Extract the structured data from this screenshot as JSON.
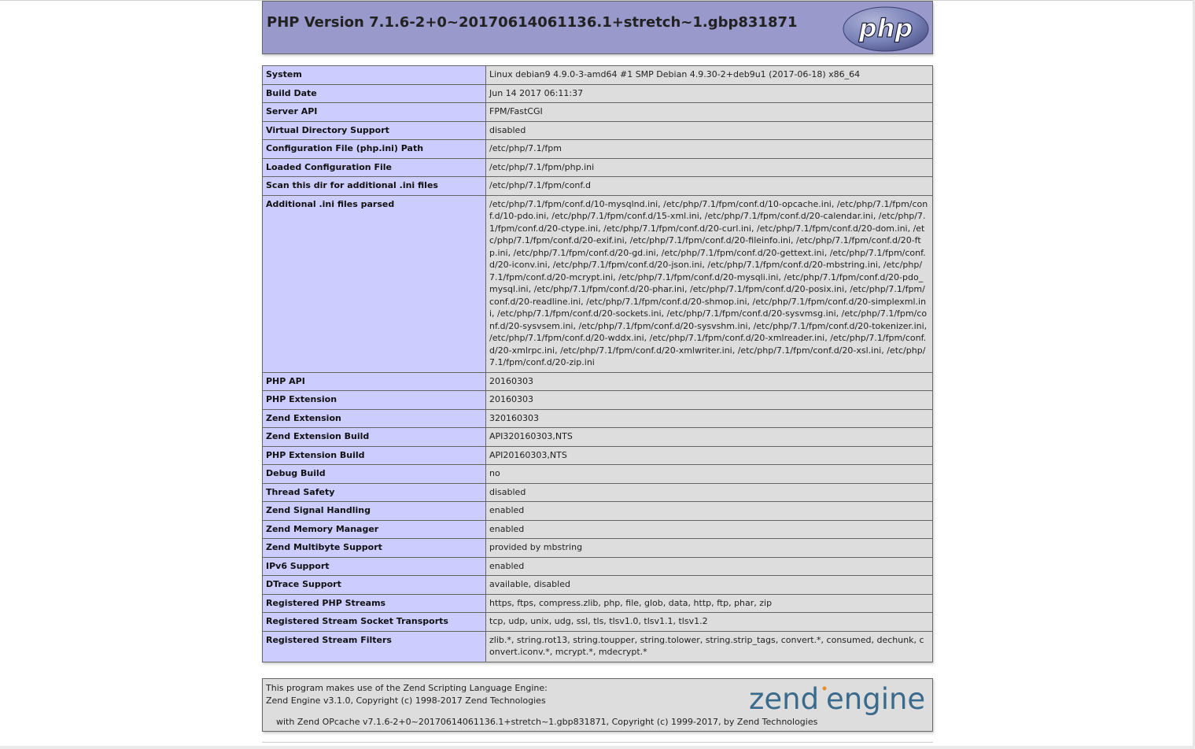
{
  "header": {
    "title": "PHP Version 7.1.6-2+0~20170614061136.1+stretch~1.gbp831871",
    "logo_text": "php",
    "logo_color": "#6c78ac",
    "background": "#9999cc"
  },
  "info_rows": [
    {
      "label": "System",
      "value": "Linux debian9 4.9.0-3-amd64 #1 SMP Debian 4.9.30-2+deb9u1 (2017-06-18) x86_64"
    },
    {
      "label": "Build Date",
      "value": "Jun 14 2017 06:11:37"
    },
    {
      "label": "Server API",
      "value": "FPM/FastCGI"
    },
    {
      "label": "Virtual Directory Support",
      "value": "disabled"
    },
    {
      "label": "Configuration File (php.ini) Path",
      "value": "/etc/php/7.1/fpm"
    },
    {
      "label": "Loaded Configuration File",
      "value": "/etc/php/7.1/fpm/php.ini"
    },
    {
      "label": "Scan this dir for additional .ini files",
      "value": "/etc/php/7.1/fpm/conf.d"
    },
    {
      "label": "Additional .ini files parsed",
      "value": "/etc/php/7.1/fpm/conf.d/10-mysqlnd.ini, /etc/php/7.1/fpm/conf.d/10-opcache.ini, /etc/php/7.1/fpm/conf.d/10-pdo.ini, /etc/php/7.1/fpm/conf.d/15-xml.ini, /etc/php/7.1/fpm/conf.d/20-calendar.ini, /etc/php/7.1/fpm/conf.d/20-ctype.ini, /etc/php/7.1/fpm/conf.d/20-curl.ini, /etc/php/7.1/fpm/conf.d/20-dom.ini, /etc/php/7.1/fpm/conf.d/20-exif.ini, /etc/php/7.1/fpm/conf.d/20-fileinfo.ini, /etc/php/7.1/fpm/conf.d/20-ftp.ini, /etc/php/7.1/fpm/conf.d/20-gd.ini, /etc/php/7.1/fpm/conf.d/20-gettext.ini, /etc/php/7.1/fpm/conf.d/20-iconv.ini, /etc/php/7.1/fpm/conf.d/20-json.ini, /etc/php/7.1/fpm/conf.d/20-mbstring.ini, /etc/php/7.1/fpm/conf.d/20-mcrypt.ini, /etc/php/7.1/fpm/conf.d/20-mysqli.ini, /etc/php/7.1/fpm/conf.d/20-pdo_mysql.ini, /etc/php/7.1/fpm/conf.d/20-phar.ini, /etc/php/7.1/fpm/conf.d/20-posix.ini, /etc/php/7.1/fpm/conf.d/20-readline.ini, /etc/php/7.1/fpm/conf.d/20-shmop.ini, /etc/php/7.1/fpm/conf.d/20-simplexml.ini, /etc/php/7.1/fpm/conf.d/20-sockets.ini, /etc/php/7.1/fpm/conf.d/20-sysvmsg.ini, /etc/php/7.1/fpm/conf.d/20-sysvsem.ini, /etc/php/7.1/fpm/conf.d/20-sysvshm.ini, /etc/php/7.1/fpm/conf.d/20-tokenizer.ini, /etc/php/7.1/fpm/conf.d/20-wddx.ini, /etc/php/7.1/fpm/conf.d/20-xmlreader.ini, /etc/php/7.1/fpm/conf.d/20-xmlrpc.ini, /etc/php/7.1/fpm/conf.d/20-xmlwriter.ini, /etc/php/7.1/fpm/conf.d/20-xsl.ini, /etc/php/7.1/fpm/conf.d/20-zip.ini"
    },
    {
      "label": "PHP API",
      "value": "20160303"
    },
    {
      "label": "PHP Extension",
      "value": "20160303"
    },
    {
      "label": "Zend Extension",
      "value": "320160303"
    },
    {
      "label": "Zend Extension Build",
      "value": "API320160303,NTS"
    },
    {
      "label": "PHP Extension Build",
      "value": "API20160303,NTS"
    },
    {
      "label": "Debug Build",
      "value": "no"
    },
    {
      "label": "Thread Safety",
      "value": "disabled"
    },
    {
      "label": "Zend Signal Handling",
      "value": "enabled"
    },
    {
      "label": "Zend Memory Manager",
      "value": "enabled"
    },
    {
      "label": "Zend Multibyte Support",
      "value": "provided by mbstring"
    },
    {
      "label": "IPv6 Support",
      "value": "enabled"
    },
    {
      "label": "DTrace Support",
      "value": "available, disabled"
    },
    {
      "label": "Registered PHP Streams",
      "value": "https, ftps, compress.zlib, php, file, glob, data, http, ftp, phar, zip"
    },
    {
      "label": "Registered Stream Socket Transports",
      "value": "tcp, udp, unix, udg, ssl, tls, tlsv1.0, tlsv1.1, tlsv1.2"
    },
    {
      "label": "Registered Stream Filters",
      "value": "zlib.*, string.rot13, string.toupper, string.tolower, string.strip_tags, convert.*, consumed, dechunk, convert.iconv.*, mcrypt.*, mdecrypt.*"
    }
  ],
  "zend": {
    "line1": "This program makes use of the Zend Scripting Language Engine:",
    "line2": "Zend Engine v3.1.0, Copyright (c) 1998-2017 Zend Technologies",
    "line3": "with Zend OPcache v7.1.6-2+0~20170614061136.1+stretch~1.gbp831871, Copyright (c) 1999-2017, by Zend Technologies",
    "logo_word1": "zend",
    "logo_word2": "engine",
    "logo_color": "#3a6b8c"
  },
  "colors": {
    "label_cell": "#ccccff",
    "value_cell": "#dddddd",
    "border": "#666666"
  }
}
